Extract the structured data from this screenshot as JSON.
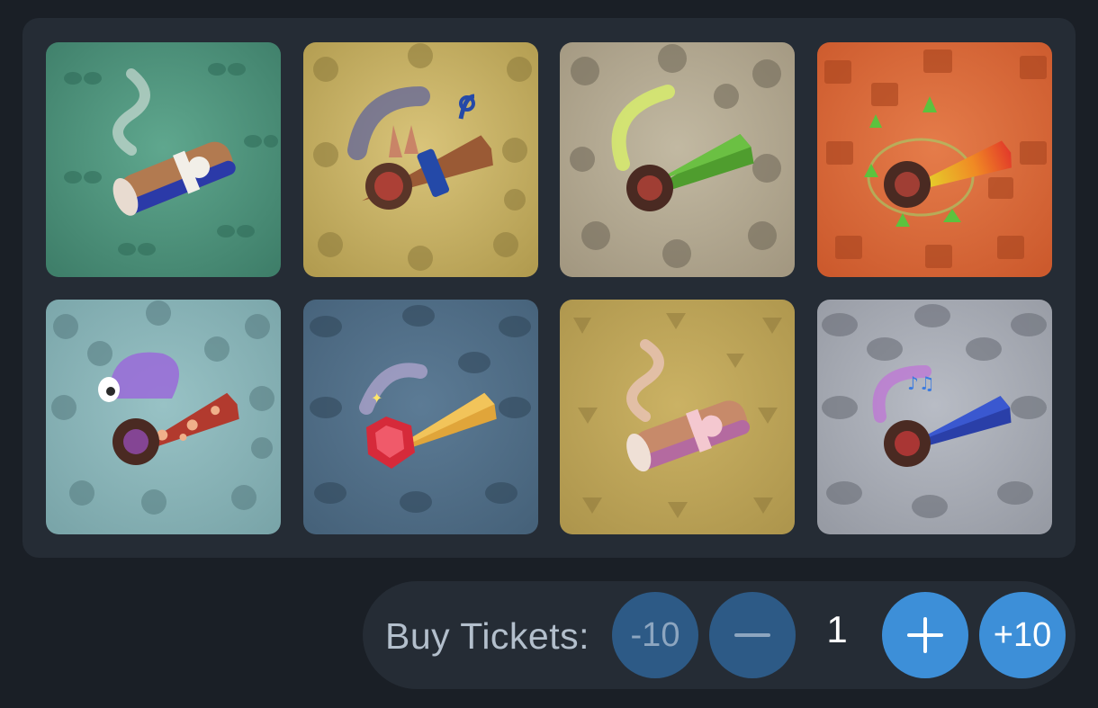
{
  "tiles": [
    {
      "icon": "cigar-icon",
      "pattern": "glasses-pattern",
      "bg": "#4f9079"
    },
    {
      "icon": "spiked-collar-joint-icon",
      "pattern": "turtle-pattern",
      "bg": "#c3ad61"
    },
    {
      "icon": "green-leaf-joint-icon",
      "pattern": "octopus-pattern",
      "bg": "#b0a58d"
    },
    {
      "icon": "rainbow-joint-icon",
      "pattern": "gift-pattern",
      "bg": "#d8683a"
    },
    {
      "icon": "mushroom-ghost-joint-icon",
      "pattern": "mouse-pattern",
      "bg": "#84b0b4"
    },
    {
      "icon": "gold-ruby-joint-icon",
      "pattern": "bird-pattern",
      "bg": "#4f6d87"
    },
    {
      "icon": "pink-cigar-icon",
      "pattern": "fox-pattern",
      "bg": "#bca458"
    },
    {
      "icon": "blue-music-joint-icon",
      "pattern": "cap-pattern",
      "bg": "#a8acb5"
    }
  ],
  "buy": {
    "label": "Buy Tickets:",
    "minus10": "-10",
    "plus10": "+10",
    "quantity": "1"
  },
  "colors": {
    "page_bg": "#1a1f26",
    "panel_bg": "#252c35",
    "button_dim": "#2d5a86",
    "button_bright": "#3d8fd8",
    "label_text": "#b3bfcc"
  }
}
